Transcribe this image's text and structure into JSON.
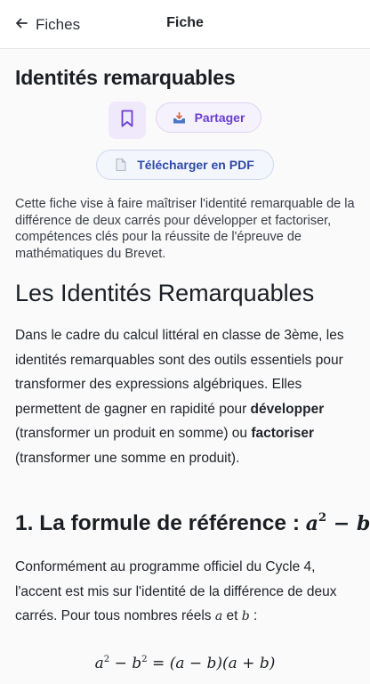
{
  "topbar": {
    "back_label": "Fiches",
    "title": "Fiche"
  },
  "fiche": {
    "title": "Identités remarquables",
    "share_label": "Partager",
    "pdf_label": "Télécharger en PDF",
    "intro": "Cette fiche vise à faire maîtriser l'identité remarquable de la différence de deux carrés pour développer et factoriser, compétences clés pour la réussite de l'épreuve de mathématiques du Brevet."
  },
  "article": {
    "h1": "Les Identités Remarquables",
    "p1_start": "Dans le cadre du calcul littéral en classe de 3ème, les identités remarquables sont des outils essentiels pour transformer des expressions algébriques. Elles permettent de gagner en rapidité pour ",
    "p1_bold1": "développer",
    "p1_mid": " (transformer un produit en somme) ou ",
    "p1_bold2": "factoriser",
    "p1_end": " (transformer une somme en produit).",
    "h2_text": "1. La formule de référence : ",
    "p2_start": "Conformément au programme officiel du Cycle 4, l'accent est mis sur l'identité de la différence de deux carrés. Pour tous nombres réels ",
    "var_a": "a",
    "p2_and": " et ",
    "var_b": "b",
    "p2_end": " :",
    "formula_lhs": "a² − b² = (a − b)(a + b)"
  },
  "colors": {
    "accent_purple": "#6b3fd0",
    "accent_blue": "#2e4aa8",
    "bookmark_bg": "#efe9fb"
  },
  "icons": {
    "back": "arrow-left-icon",
    "bookmark": "bookmark-icon",
    "share": "share-tray-icon",
    "pdf": "document-icon"
  }
}
